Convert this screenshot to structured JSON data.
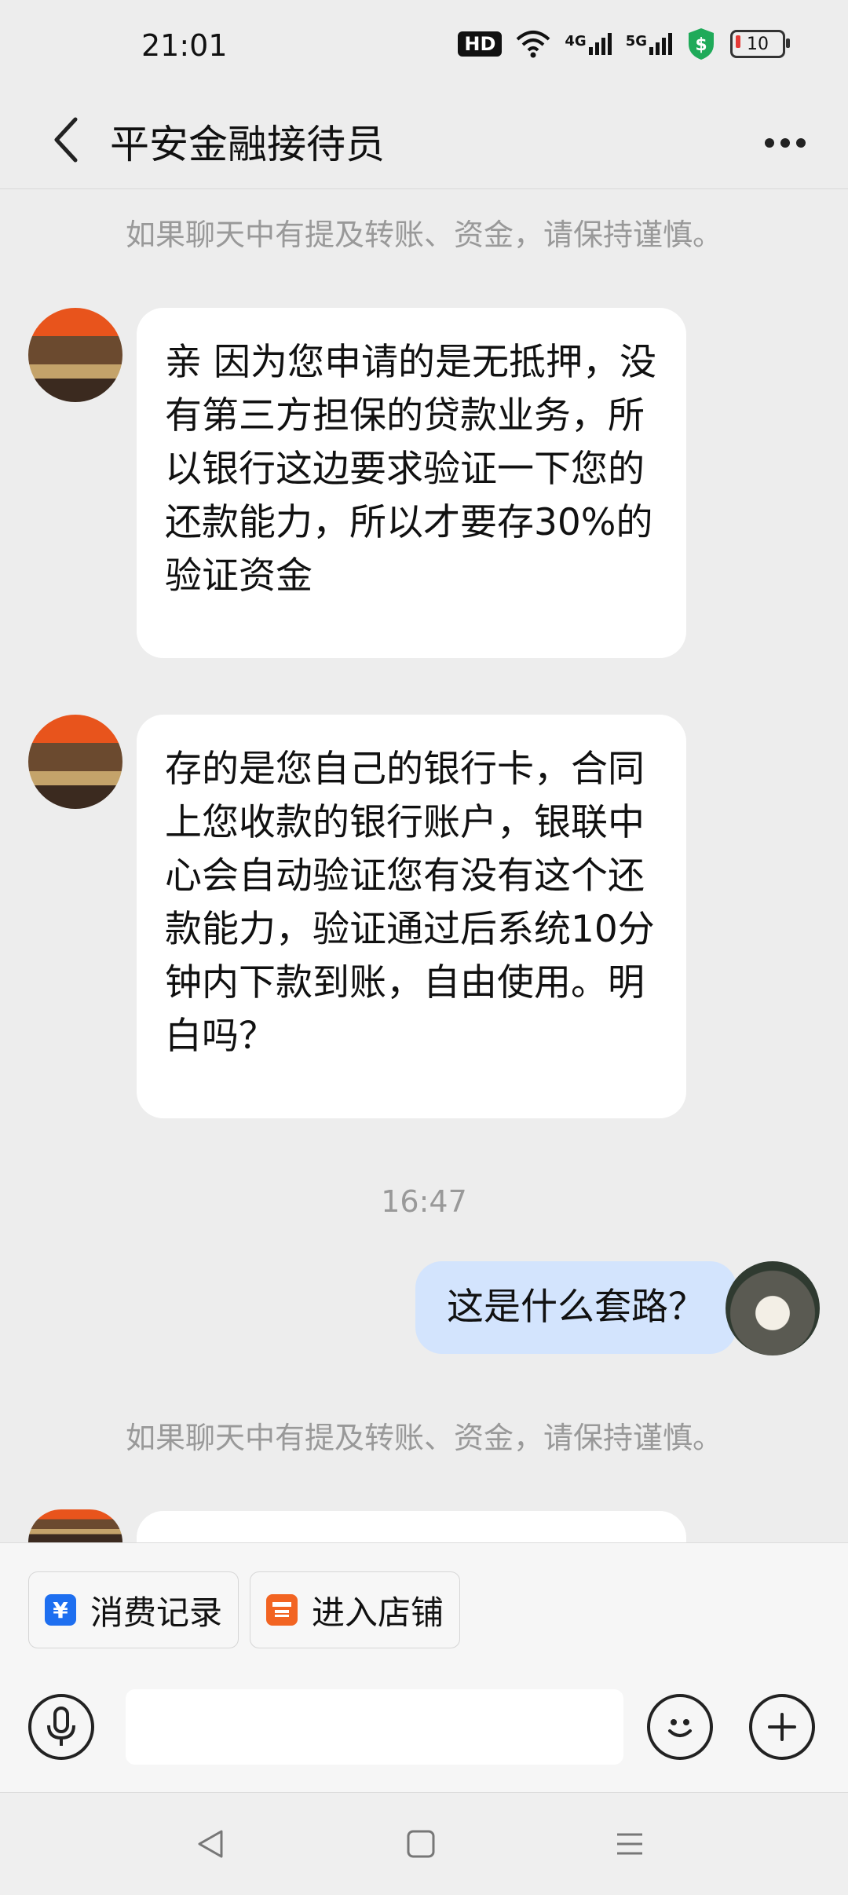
{
  "status_bar": {
    "time": "21:01",
    "hd_label": "HD",
    "network_4g": "4G",
    "network_5g": "5G",
    "battery_level": "10",
    "icons": [
      "hd-icon",
      "wifi-icon",
      "signal-4g-icon",
      "signal-5g-icon",
      "security-shield-icon",
      "battery-icon"
    ]
  },
  "header": {
    "title": "平安金融接待员",
    "back_icon": "chevron-left-icon",
    "more_icon": "more-dots-icon"
  },
  "chat": {
    "notice_1": "如果聊天中有提及转账、资金，请保持谨慎。",
    "message_1": "亲 因为您申请的是无抵押，没有第三方担保的贷款业务，所以银行这边要求验证一下您的还款能力，所以才要存30%的验证资金",
    "message_2": "存的是您自己的银行卡，合同上您收款的银行账户，银联中心会自动验证您有没有这个还款能力，验证通过后系统10分钟内下款到账，自由使用。明白吗？",
    "timestamp": "16:47",
    "message_3": "这是什么套路？",
    "notice_2": "如果聊天中有提及转账、资金，请保持谨慎。"
  },
  "quick_actions": {
    "consumption_record": "消费记录",
    "enter_store": "进入店铺"
  },
  "input_bar": {
    "placeholder": "",
    "voice_icon": "microphone-icon",
    "emoji_icon": "emoji-icon",
    "add_icon": "plus-icon"
  },
  "colors": {
    "background": "#ededed",
    "own_bubble": "#d3e4fd",
    "other_bubble": "#ffffff",
    "record_icon": "#1e6ff0",
    "store_icon": "#f26422"
  }
}
